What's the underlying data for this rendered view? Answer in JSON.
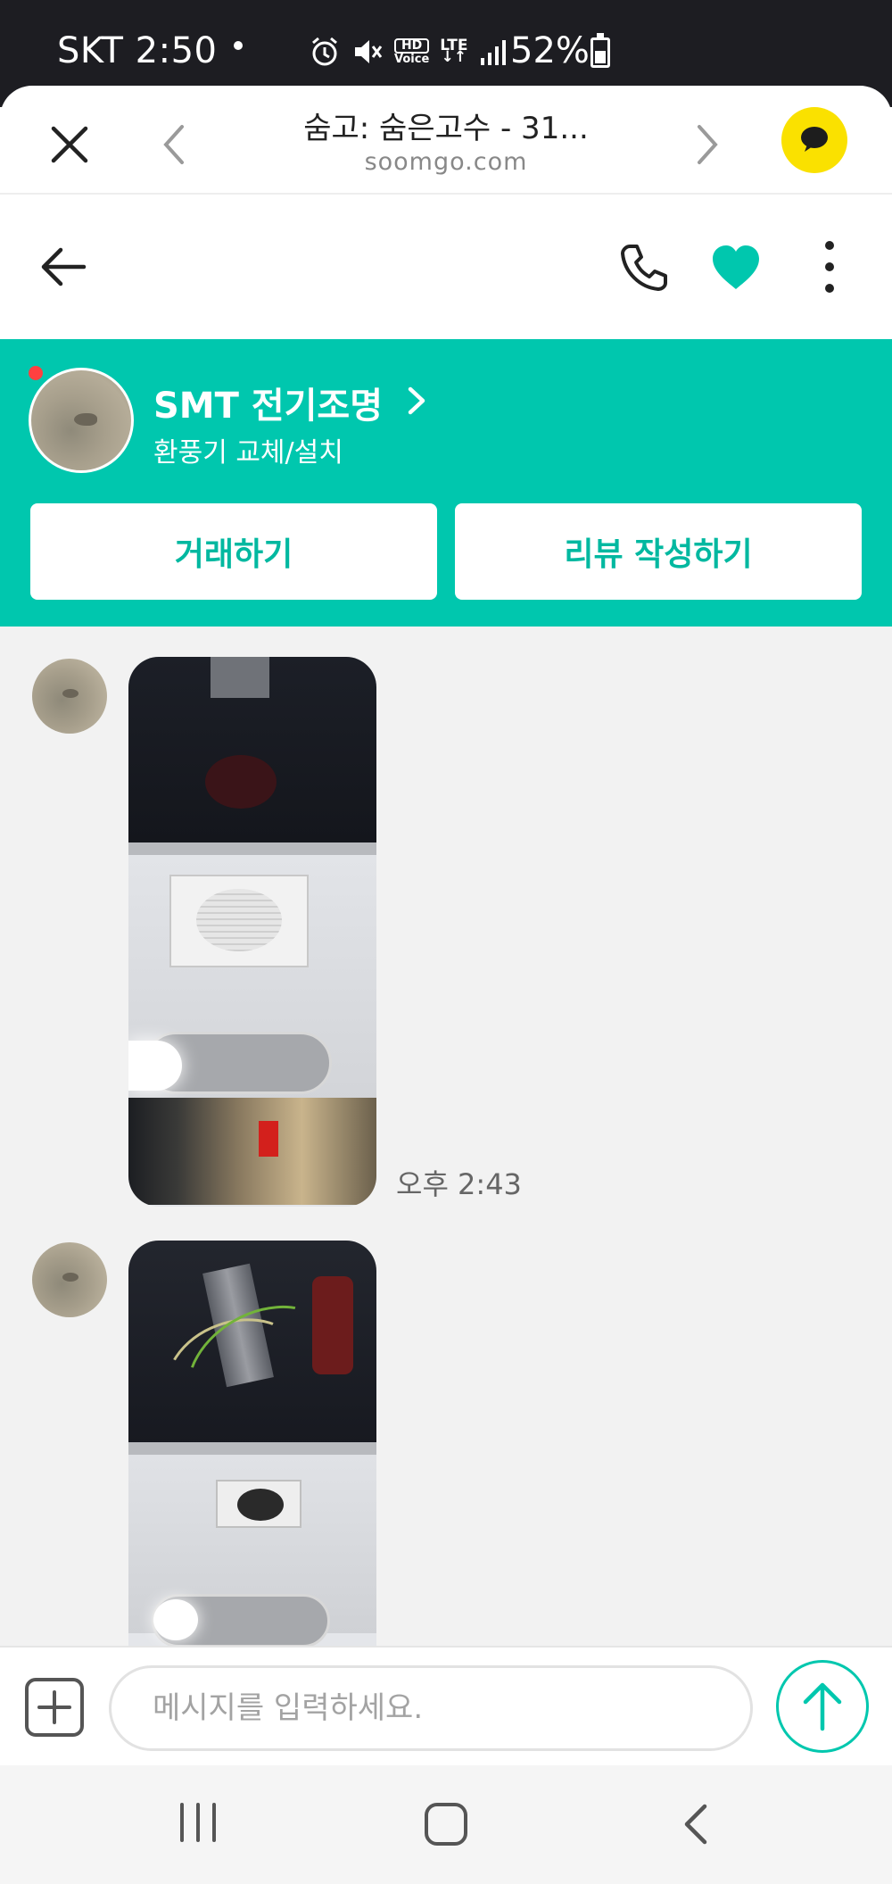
{
  "status_bar": {
    "carrier_time": "SKT 2:50",
    "hd_label": "HD",
    "voice_label": "Voice",
    "lte_label": "LTE",
    "battery_percent": "52%",
    "battery_level": 0.52
  },
  "browser": {
    "title": "숨고: 숨은고수 - 31...",
    "url": "soomgo.com",
    "icons": [
      "close-icon",
      "chevron-left-icon",
      "chevron-right-icon",
      "kakao-chat-icon"
    ]
  },
  "header": {
    "icons": [
      "back-arrow-icon",
      "phone-icon",
      "heart-icon",
      "more-vertical-icon"
    ],
    "favorited": true
  },
  "pro": {
    "name": "SMT 전기조명",
    "service": "환풍기 교체/설치",
    "online": true,
    "deal_button": "거래하기",
    "review_button": "리뷰 작성하기"
  },
  "messages": [
    {
      "type": "image",
      "description_icon": "photo-ceiling-fan",
      "time": "오후 2:43"
    },
    {
      "type": "image",
      "description_icon": "photo-ceiling-fan-open",
      "time": ""
    }
  ],
  "input": {
    "placeholder": "메시지를 입력하세요.",
    "value": ""
  },
  "colors": {
    "brand": "#00c7ae",
    "status_bar_bg": "#1d1d22",
    "chat_bg": "#f2f2f2",
    "kakao_yellow": "#fae100",
    "online_dot": "#ff4040"
  }
}
